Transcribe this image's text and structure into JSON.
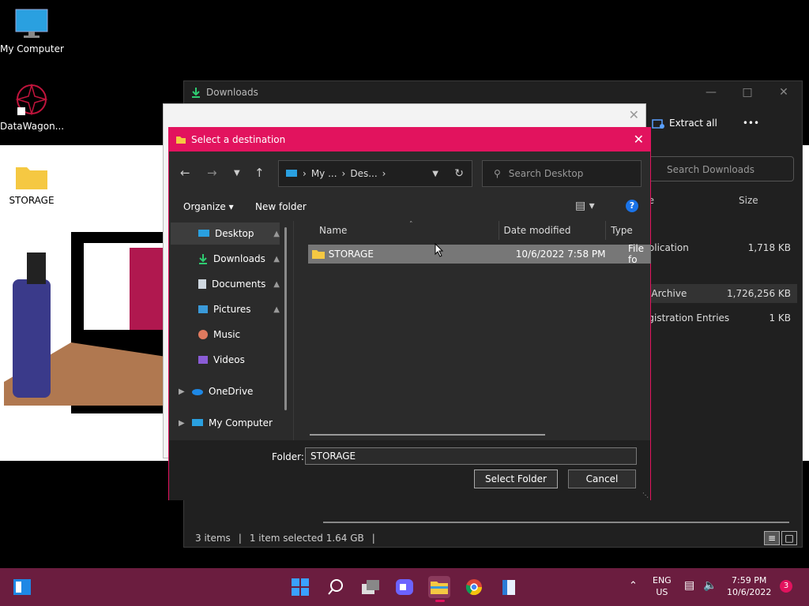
{
  "desktop": {
    "icons": [
      {
        "label": "My Computer"
      },
      {
        "label": "DataWagon..."
      },
      {
        "label": "STORAGE"
      }
    ]
  },
  "downloads": {
    "title": "Downloads",
    "extract_all": "Extract all",
    "more": "•••",
    "search_placeholder": "Search Downloads",
    "cols": {
      "type": "pe",
      "size": "Size"
    },
    "rows": [
      {
        "type": "pplication",
        "size": "1,718 KB"
      },
      {
        "type": "p Archive",
        "size": "1,726,256 KB"
      },
      {
        "type": "egistration Entries",
        "size": "1 KB"
      }
    ],
    "status": {
      "items": "3 items",
      "selected": "1 item selected  1.64 GB"
    }
  },
  "dialog": {
    "title": "Select a destination",
    "breadcrumb": [
      "My ...",
      "Des..."
    ],
    "search_placeholder": "Search Desktop",
    "organize": "Organize",
    "new_folder": "New folder",
    "help": "?",
    "nav": [
      {
        "label": "Desktop"
      },
      {
        "label": "Downloads"
      },
      {
        "label": "Documents"
      },
      {
        "label": "Pictures"
      },
      {
        "label": "Music"
      },
      {
        "label": "Videos"
      },
      {
        "label": "OneDrive"
      },
      {
        "label": "My Computer"
      }
    ],
    "columns": {
      "name": "Name",
      "date": "Date modified",
      "type": "Type"
    },
    "files": [
      {
        "name": "STORAGE",
        "date": "10/6/2022 7:58 PM",
        "type": "File fo"
      }
    ],
    "folder_label": "Folder:",
    "folder_value": "STORAGE",
    "select_btn": "Select Folder",
    "cancel_btn": "Cancel"
  },
  "taskbar": {
    "lang": "ENG",
    "region": "US",
    "time": "7:59 PM",
    "date": "10/6/2022",
    "notifications": "3"
  },
  "colors": {
    "accent": "#e2135e",
    "taskbar": "#6b1d3f"
  }
}
